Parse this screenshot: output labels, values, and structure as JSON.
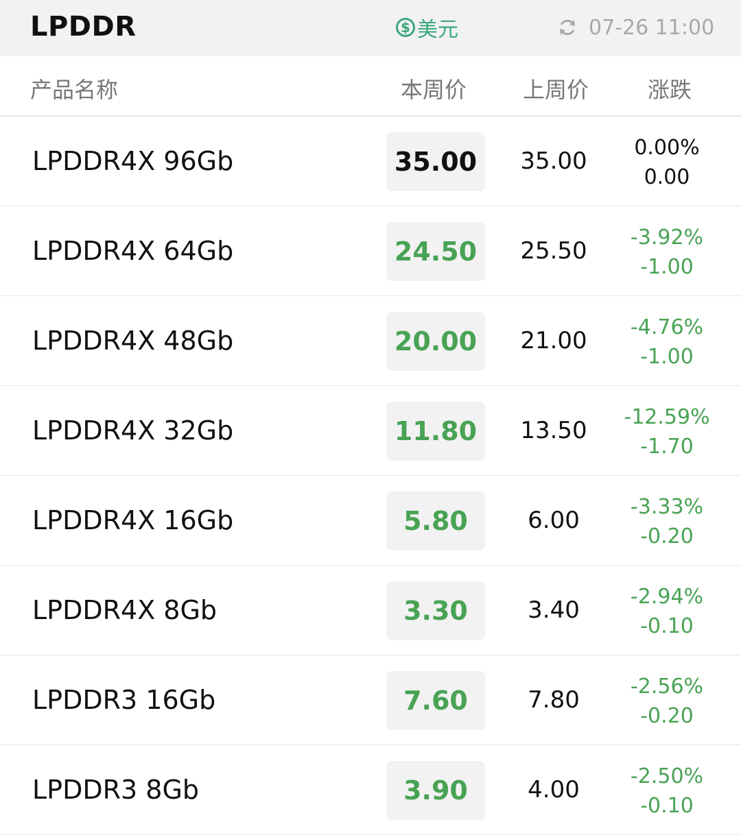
{
  "header": {
    "title": "LPDDR",
    "currency_symbol": "$",
    "currency_label": "美元",
    "updated_time": "07-26 11:00",
    "icons": {
      "currency": "dollar-coin-icon",
      "refresh": "refresh-icon"
    }
  },
  "columns": {
    "name": "产品名称",
    "current": "本周价",
    "previous": "上周价",
    "change": "涨跌"
  },
  "colors": {
    "down": "#48a354",
    "flat": "#111111",
    "accent": "#3aa77d",
    "muted": "#a8a8a8"
  },
  "rows": [
    {
      "name": "LPDDR4X 96Gb",
      "current": "35.00",
      "previous": "35.00",
      "change_pct": "0.00%",
      "change_abs": "0.00",
      "trend": "flat"
    },
    {
      "name": "LPDDR4X 64Gb",
      "current": "24.50",
      "previous": "25.50",
      "change_pct": "-3.92%",
      "change_abs": "-1.00",
      "trend": "down"
    },
    {
      "name": "LPDDR4X 48Gb",
      "current": "20.00",
      "previous": "21.00",
      "change_pct": "-4.76%",
      "change_abs": "-1.00",
      "trend": "down"
    },
    {
      "name": "LPDDR4X 32Gb",
      "current": "11.80",
      "previous": "13.50",
      "change_pct": "-12.59%",
      "change_abs": "-1.70",
      "trend": "down"
    },
    {
      "name": "LPDDR4X 16Gb",
      "current": "5.80",
      "previous": "6.00",
      "change_pct": "-3.33%",
      "change_abs": "-0.20",
      "trend": "down"
    },
    {
      "name": "LPDDR4X 8Gb",
      "current": "3.30",
      "previous": "3.40",
      "change_pct": "-2.94%",
      "change_abs": "-0.10",
      "trend": "down"
    },
    {
      "name": "LPDDR3 16Gb",
      "current": "7.60",
      "previous": "7.80",
      "change_pct": "-2.56%",
      "change_abs": "-0.20",
      "trend": "down"
    },
    {
      "name": "LPDDR3 8Gb",
      "current": "3.90",
      "previous": "4.00",
      "change_pct": "-2.50%",
      "change_abs": "-0.10",
      "trend": "down"
    }
  ]
}
